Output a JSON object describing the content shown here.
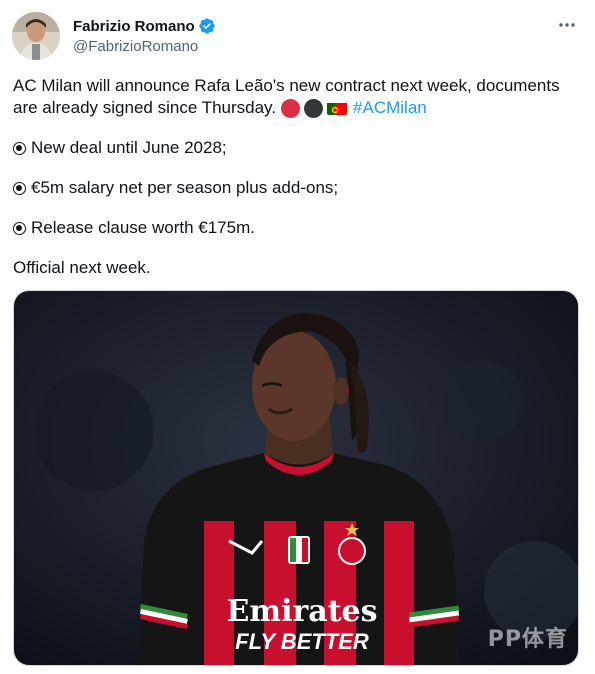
{
  "author": {
    "display_name": "Fabrizio Romano",
    "handle": "@FabrizioRomano",
    "verified_icon": "verified-badge-icon"
  },
  "tweet": {
    "line1": "AC Milan will announce Rafa Leão's new contract next week, documents",
    "line2": "are already signed since Thursday.",
    "emojis": [
      "red-circle",
      "black-circle",
      "portugal-flag"
    ],
    "hashtag": "#ACMilan",
    "bullets": [
      "New deal until June 2028;",
      "€5m salary net per season plus add-ons;",
      "Release clause worth €175m."
    ],
    "closing": "Official next week."
  },
  "media": {
    "sponsor_line1": "Emirates",
    "sponsor_line2": "FLY BETTER",
    "watermark": "PP体育"
  },
  "colors": {
    "link": "#1d9bf0",
    "verified": "#1d9bf0",
    "milan_red": "#c8102e"
  }
}
